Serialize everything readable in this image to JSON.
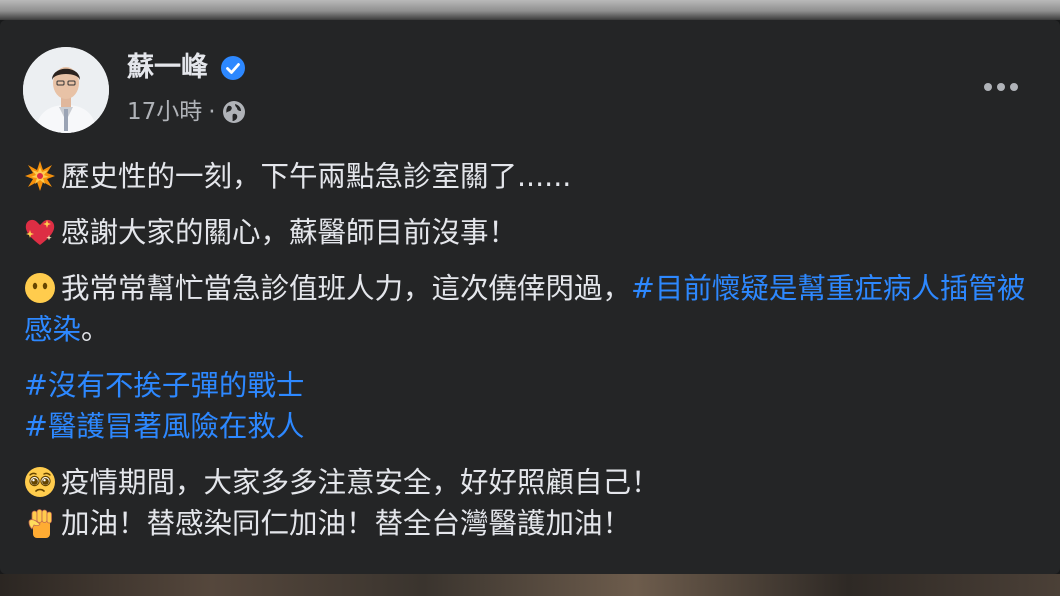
{
  "post": {
    "author": "蘇一峰",
    "timestamp": "17小時",
    "separator": "·",
    "privacy_icon": "globe-icon",
    "verified_icon": "verified-badge-icon",
    "more_icon": "more-options-icon",
    "paragraphs": [
      {
        "emoji": "collision-emoji",
        "text": "歷史性的一刻，下午兩點急診室關了......"
      },
      {
        "emoji": "sparkling-heart-emoji",
        "text": "感謝大家的關心，蘇醫師目前沒事！"
      },
      {
        "emoji": "no-mouth-face-emoji",
        "text": "我常常幫忙當急診值班人力，這次僥倖閃過，",
        "hashtag": "#目前懷疑是幫重症病人插管被感染",
        "suffix": "。"
      }
    ],
    "hashtags": [
      "#沒有不挨子彈的戰士",
      "#醫護冒著風險在救人"
    ],
    "closing": [
      {
        "emoji": "pleading-face-emoji",
        "text": "疫情期間，大家多多注意安全，好好照顧自己！"
      },
      {
        "emoji": "raised-fist-emoji",
        "text": "加油！替感染同仁加油！替全台灣醫護加油！"
      }
    ]
  },
  "colors": {
    "background": "#18191a",
    "card": "#242526",
    "text_primary": "#e4e6eb",
    "text_secondary": "#b0b3b8",
    "hashtag": "#2d88ff",
    "verified": "#2d88ff"
  }
}
